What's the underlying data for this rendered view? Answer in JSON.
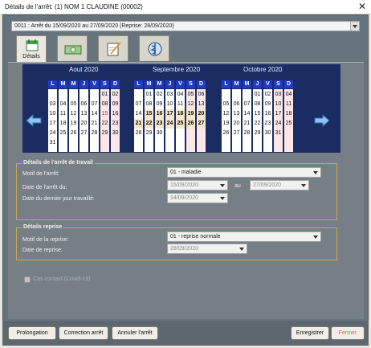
{
  "window": {
    "title": "Détails de l'arrêt: (1) NOM 1 CLAUDINE (00002)",
    "close_glyph": "✕"
  },
  "arret_select": {
    "value": "0011 : Arrêt du 15/09/2020 au 27/09/2020 (Reprise: 28/09/2020)"
  },
  "tabs": [
    {
      "label": "Détails",
      "icon": "calendar-icon",
      "active": true
    },
    {
      "label": "",
      "icon": "money-icon"
    },
    {
      "label": "",
      "icon": "notepad-icon"
    },
    {
      "label": "",
      "icon": "medical-icon"
    }
  ],
  "calendar": {
    "months": [
      {
        "name": "Aout 2020",
        "dow": [
          "L",
          "M",
          "M",
          "J",
          "V",
          "S",
          "D"
        ],
        "weeks": [
          [
            "",
            "",
            "",
            "",
            "",
            "01",
            "02"
          ],
          [
            "03",
            "04",
            "05",
            "06",
            "07",
            "08",
            "09"
          ],
          [
            "10",
            "11",
            "12",
            "13",
            "14",
            "15",
            "16"
          ],
          [
            "17",
            "18",
            "19",
            "20",
            "21",
            "22",
            "23"
          ],
          [
            "24",
            "25",
            "26",
            "27",
            "28",
            "29",
            "30"
          ],
          [
            "31",
            "",
            "",
            "",
            "",
            "",
            ""
          ]
        ]
      },
      {
        "name": "Septembre 2020",
        "dow": [
          "L",
          "M",
          "M",
          "J",
          "V",
          "S",
          "D"
        ],
        "weeks": [
          [
            "",
            "01",
            "02",
            "03",
            "04",
            "05",
            "06"
          ],
          [
            "07",
            "08",
            "09",
            "10",
            "11",
            "12",
            "13"
          ],
          [
            "14",
            "15",
            "16",
            "17",
            "18",
            "19",
            "20"
          ],
          [
            "21",
            "22",
            "23",
            "24",
            "25",
            "26",
            "27"
          ],
          [
            "28",
            "29",
            "30",
            "",
            "",
            "",
            ""
          ],
          [
            "",
            "",
            "",
            "",
            "",
            "",
            ""
          ]
        ]
      },
      {
        "name": "Octobre 2020",
        "dow": [
          "L",
          "M",
          "M",
          "J",
          "V",
          "S",
          "D"
        ],
        "weeks": [
          [
            "",
            "",
            "",
            "01",
            "02",
            "03",
            "04"
          ],
          [
            "05",
            "06",
            "07",
            "08",
            "09",
            "10",
            "11"
          ],
          [
            "12",
            "13",
            "14",
            "15",
            "16",
            "17",
            "18"
          ],
          [
            "19",
            "20",
            "21",
            "22",
            "23",
            "24",
            "25"
          ],
          [
            "26",
            "27",
            "28",
            "29",
            "30",
            "31",
            ""
          ],
          [
            "",
            "",
            "",
            "",
            "",
            "",
            ""
          ]
        ]
      }
    ],
    "highlight_range": {
      "month": "Septembre 2020",
      "from": "15",
      "to": "27"
    },
    "holiday": {
      "month": "Aout 2020",
      "day": "15"
    },
    "colors": {
      "header_bg": "#1b2c62",
      "dow_bg": "#1f3bc5",
      "range_bg": "#f6e6cb",
      "weekend_bg": "#fbe7e7",
      "holiday_text": "#cc3333"
    }
  },
  "arret_section": {
    "title": "Détails de l'arrêt de travail",
    "motif_label": "Motif de l'arrêt:",
    "motif_value": "01 - maladie",
    "date_du_label": "Date de l'arrêt du:",
    "date_du_value": "15/09/2020",
    "au_label": "au",
    "date_au_value": "27/09/2020",
    "dernier_jour_label": "Date du dernier jour travaillé:",
    "dernier_jour_value": "14/09/2020"
  },
  "reprise_section": {
    "title": "Détails reprise",
    "motif_label": "Motif de la reprise:",
    "motif_value": "01 - reprise normale",
    "date_label": "Date de reprise:",
    "date_value": "28/09/2020"
  },
  "covid_checkbox": {
    "label": "Cas contact (Covid-19)",
    "checked": false
  },
  "buttons": {
    "prolongation": "Prolongation",
    "correction": "Correction arrêt",
    "annuler": "Annuler l'arrêt",
    "enregistrer": "Enregistrer",
    "fermer": "Fermer"
  }
}
